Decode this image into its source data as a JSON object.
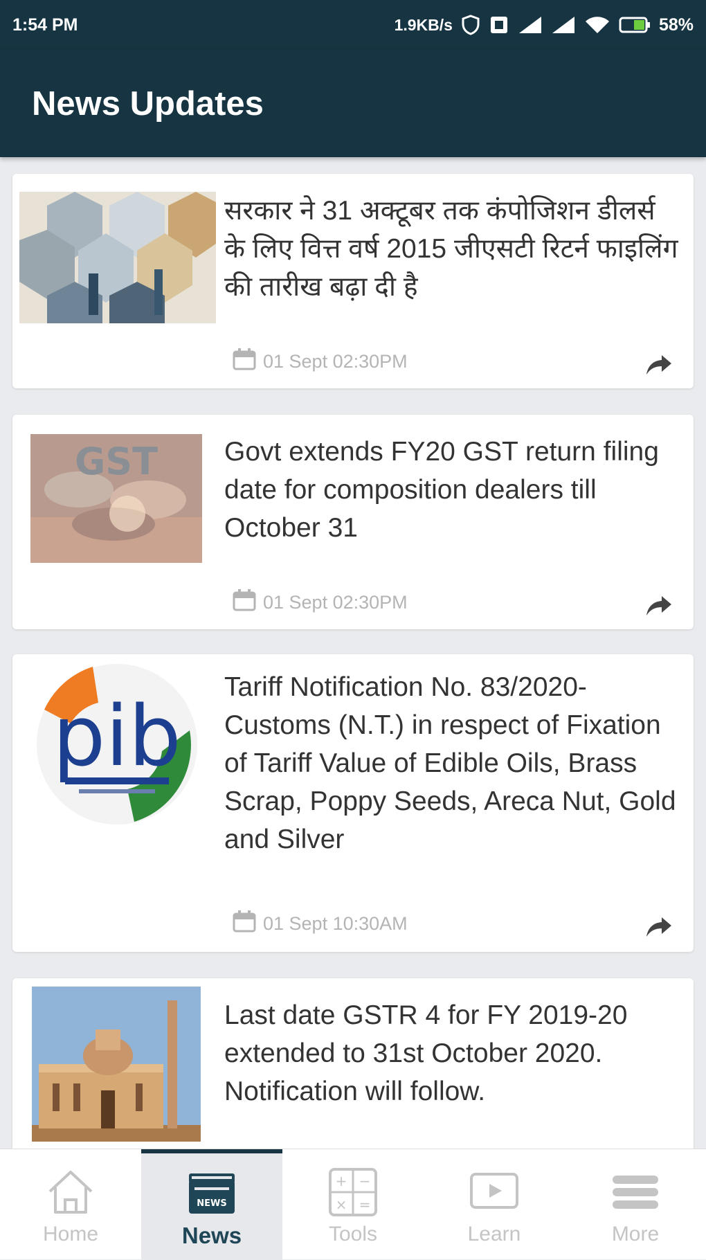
{
  "status_bar": {
    "time": "1:54 PM",
    "network_speed": "1.9KB/s",
    "battery": "58%",
    "icons": [
      "shield-icon",
      "sim-card-icon",
      "signal-icon",
      "signal-icon",
      "wifi-icon",
      "battery-icon"
    ]
  },
  "app_bar": {
    "title": "News Updates"
  },
  "news": [
    {
      "headline": "सरकार ने 31 अक्टूबर तक कंपोजिशन डीलर्स के लिए वित्त वर्ष 2015 जीएसटी रिटर्न फाइलिंग की तारीख बढ़ा दी है",
      "date": "01 Sept 02:30PM",
      "image": "hexagon-collage-office"
    },
    {
      "headline": "Govt extends FY20 GST return filing date for composition dealers till October 31",
      "date": "01 Sept 02:30PM",
      "image": "gst-coins-banknotes"
    },
    {
      "headline": "Tariff Notification No. 83/2020-Customs (N.T.) in respect of Fixation of Tariff Value of Edible Oils, Brass Scrap, Poppy Seeds, Areca Nut, Gold and Silver",
      "date": "01 Sept 10:30AM",
      "image": "pib-logo"
    },
    {
      "headline": "Last date GSTR 4 for FY 2019-20 extended to 31st October 2020. Notification will follow.",
      "date": "",
      "image": "government-building"
    }
  ],
  "bottom_nav": [
    {
      "label": "Home",
      "icon": "home-icon",
      "active": false
    },
    {
      "label": "News",
      "icon": "newspaper-icon",
      "active": true
    },
    {
      "label": "Tools",
      "icon": "calculator-icon",
      "active": false
    },
    {
      "label": "Learn",
      "icon": "play-icon",
      "active": false
    },
    {
      "label": "More",
      "icon": "menu-icon",
      "active": false
    }
  ],
  "colors": {
    "app_bar": "#163441",
    "background": "#e9ebee",
    "card": "#ffffff",
    "headline_text": "#333333",
    "meta_text": "#b4b4b4",
    "nav_active": "#1f4656",
    "nav_inactive": "#c4c4c4"
  }
}
